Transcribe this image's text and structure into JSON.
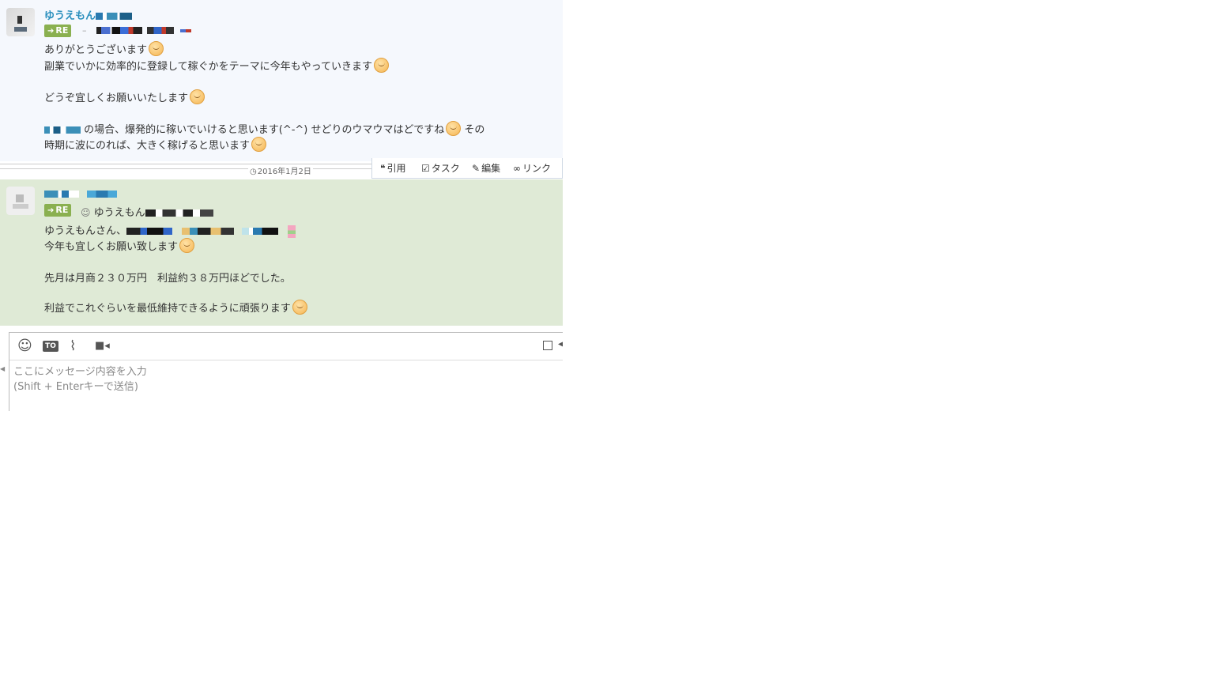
{
  "msg1": {
    "sender": "ゆうえもん",
    "re_label": "RE",
    "lines": [
      "ありがとうございます",
      "副業でいかに効率的に登録して稼ぐかをテーマに今年もやっていきます",
      "どうぞ宜しくお願いいたします",
      "の場合、爆発的に稼いでいけると思います(^-^) せどりのウマウマはどですね",
      "その",
      "時期に波にのれば、大きく稼げると思います"
    ]
  },
  "date": "2016年1月2日",
  "actions": {
    "quote": "引用",
    "task": "タスク",
    "edit": "編集",
    "link": "リンク"
  },
  "msg2": {
    "re_label": "RE",
    "re_target": "ゆうえもん",
    "lines": [
      "ゆうえもんさん、",
      "今年も宜しくお願い致します",
      "先月は月商２３０万円　利益約３８万円ほどでした。",
      "利益でこれぐらいを最低維持できるように頑張ります"
    ]
  },
  "composer": {
    "to_label": "TO",
    "placeholder_line1": "ここにメッセージ内容を入力",
    "placeholder_line2": "(Shift + Enterキーで送信)"
  },
  "icons": [
    "emoji-icon",
    "to-icon",
    "paperclip-icon",
    "video-icon",
    "clock-icon",
    "quote-icon",
    "task-icon",
    "edit-icon",
    "link-icon"
  ]
}
